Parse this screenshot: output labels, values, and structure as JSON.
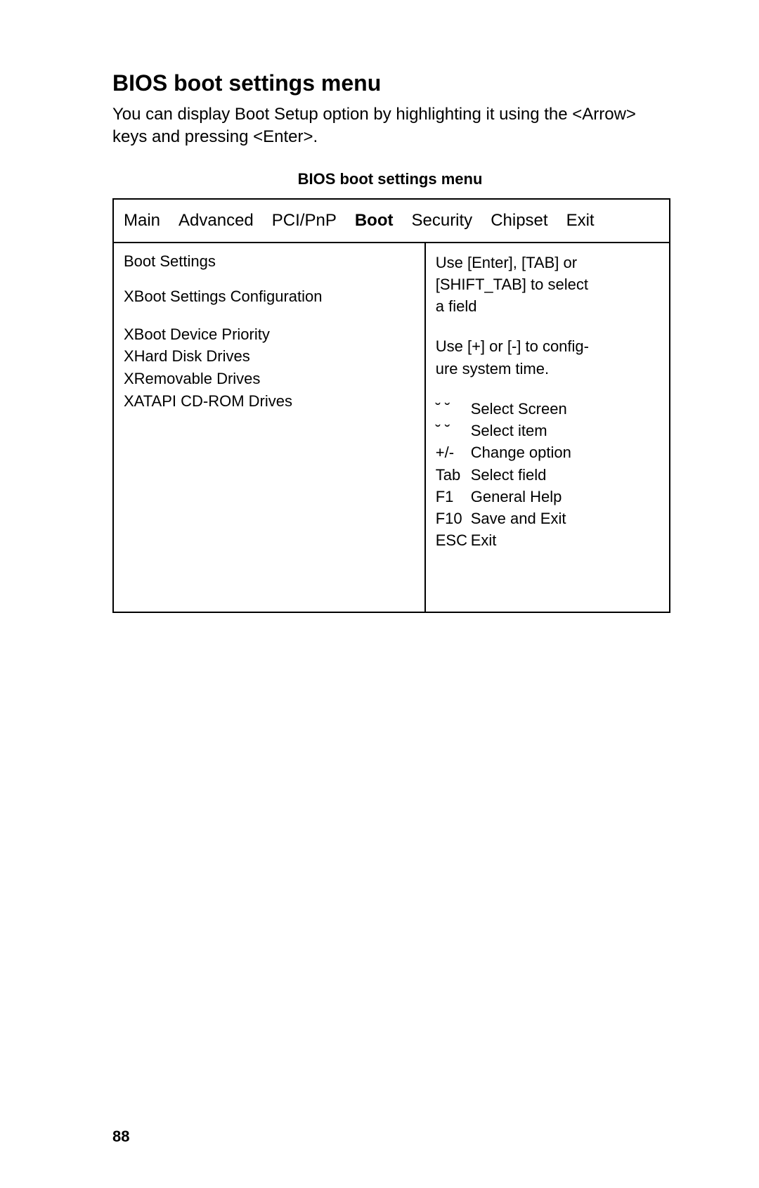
{
  "section_title": "BIOS boot settings menu",
  "intro_text": "You can display Boot Setup option by highlighting it using the <Arrow> keys and pressing <Enter>.",
  "caption": "BIOS boot settings menu",
  "tabs": {
    "items": [
      "Main",
      "Advanced",
      "PCI/PnP",
      "Boot",
      "Security",
      "Chipset",
      "Exit"
    ],
    "active": "Boot"
  },
  "left_panel": {
    "title": "Boot Settings",
    "group1": [
      "XBoot Settings Configuration"
    ],
    "group2": [
      "XBoot Device Priority",
      "XHard Disk Drives",
      "XRemovable Drives",
      "XATAPI CD-ROM Drives"
    ]
  },
  "right_panel": {
    "help1_line1": "Use [Enter], [TAB] or",
    "help1_line2": "[SHIFT_TAB] to select",
    "help1_line3": "a field",
    "help2_line1": "Use [+] or [-] to config-",
    "help2_line2": "ure system time.",
    "keys": [
      {
        "k": "˘ ˘",
        "d": "Select Screen"
      },
      {
        "k": "˘ ˘",
        "d": "Select item"
      },
      {
        "k": "+/-",
        "d": "Change option"
      },
      {
        "k": "Tab",
        "d": "Select field"
      },
      {
        "k": "F1",
        "d": "General Help"
      },
      {
        "k": "F10",
        "d": "Save and Exit"
      },
      {
        "k": "ESC",
        "d": "Exit"
      }
    ]
  },
  "page_number": "88"
}
